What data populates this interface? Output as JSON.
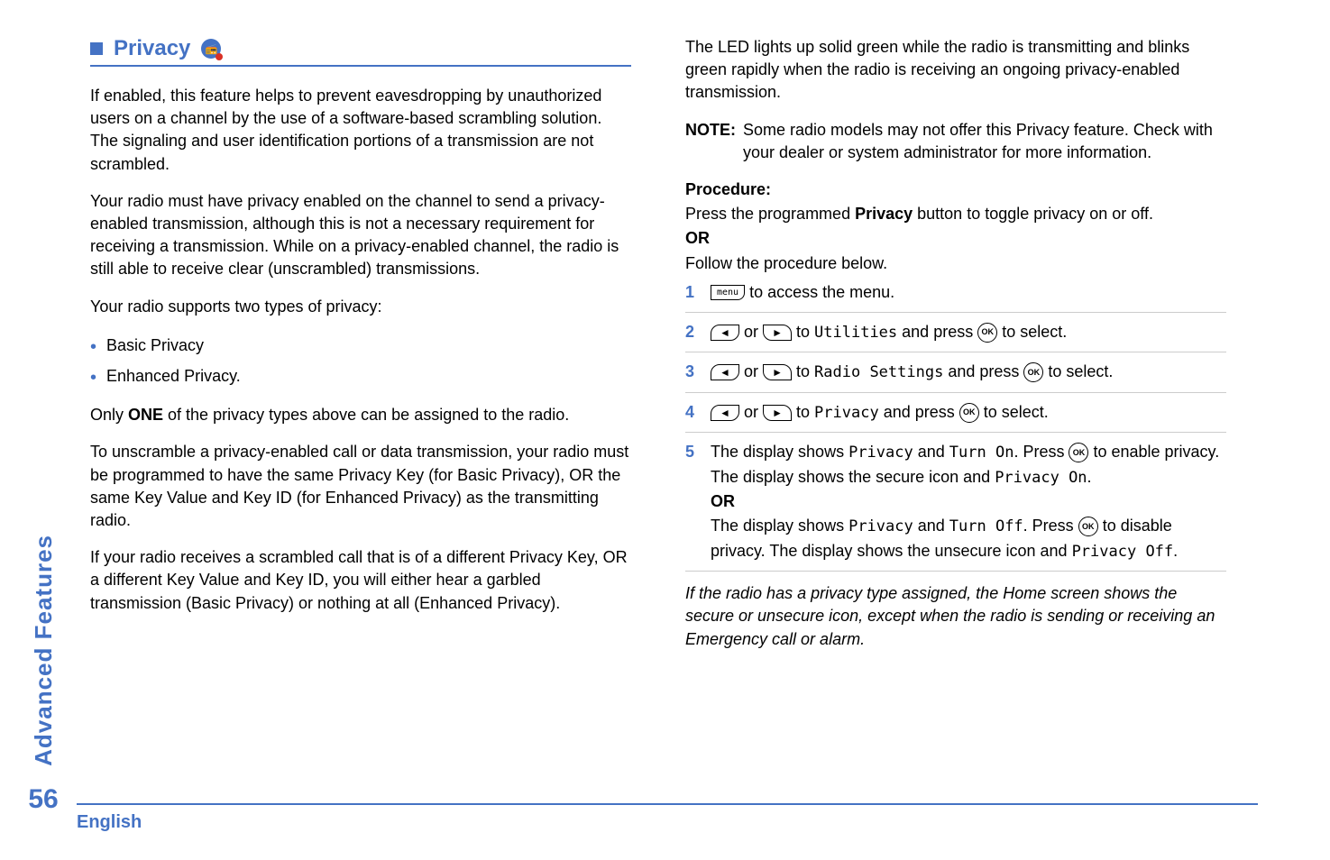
{
  "sidebar": {
    "label": "Advanced Features",
    "page_number": "56"
  },
  "heading": {
    "title": "Privacy"
  },
  "left_column": {
    "p1": "If enabled, this feature helps to prevent eavesdropping by unauthorized users on a channel by the use of a software-based scrambling solution. The signaling and user identification portions of a transmission are not scrambled.",
    "p2": "Your radio must have privacy enabled on the channel to send a privacy-enabled transmission, although this is not a necessary requirement for receiving a transmission. While on a privacy-enabled channel, the radio is still able to receive clear (unscrambled) transmissions.",
    "p3": "Your radio supports two types of privacy:",
    "bullets": [
      "Basic Privacy",
      "Enhanced Privacy."
    ],
    "p4_pre": "Only ",
    "p4_bold": "ONE",
    "p4_post": " of the privacy types above can be assigned to the radio.",
    "p5": "To unscramble a privacy-enabled call or data transmission, your radio must be programmed to have the same Privacy Key (for Basic Privacy), OR the same Key Value and Key ID (for Enhanced Privacy) as the transmitting radio.",
    "p6": "If your radio receives a scrambled call that is of a different Privacy Key, OR a different Key Value and Key ID, you will either hear a garbled transmission (Basic Privacy) or nothing at all (Enhanced Privacy)."
  },
  "right_column": {
    "p1": "The LED lights up solid green while the radio is transmitting and blinks green rapidly when the radio is receiving an ongoing privacy-enabled transmission.",
    "note_label": "NOTE:",
    "note_text": "Some radio models may not offer this Privacy feature. Check with your dealer or system administrator for more information.",
    "procedure_label": "Procedure:",
    "procedure_intro_pre": "Press the programmed ",
    "procedure_intro_bold": "Privacy",
    "procedure_intro_post": " button to toggle privacy on or off.",
    "or_label": "OR",
    "follow_text": "Follow the procedure below.",
    "steps": {
      "s1": " to access the menu.",
      "s2_pre": " or ",
      "s2_mid": " to ",
      "s2_lcd": "Utilities",
      "s2_post": " and press ",
      "s2_end": " to select.",
      "s3_lcd": "Radio Settings",
      "s4_lcd": "Privacy",
      "s5_pre": "The display shows ",
      "s5_lcd1": "Privacy",
      "s5_and": " and ",
      "s5_lcd2": "Turn On",
      "s5_press": ". Press ",
      "s5_post": " to enable privacy. The display shows the secure icon and ",
      "s5_lcd3": "Privacy On",
      "s5_dot": ".",
      "s5_or": "OR",
      "s5b_pre": "The display shows ",
      "s5b_lcd1": "Privacy",
      "s5b_and": " and ",
      "s5b_lcd2": "Turn Off",
      "s5b_press": ". Press ",
      "s5b_post": " to disable privacy. The display shows the unsecure icon and ",
      "s5b_lcd3": "Privacy Off",
      "s5b_dot": "."
    },
    "footer_note": "If the radio has a privacy type assigned, the Home screen shows the secure or unsecure icon, except when the radio is sending or receiving an Emergency call or alarm."
  },
  "footer": {
    "language": "English"
  }
}
